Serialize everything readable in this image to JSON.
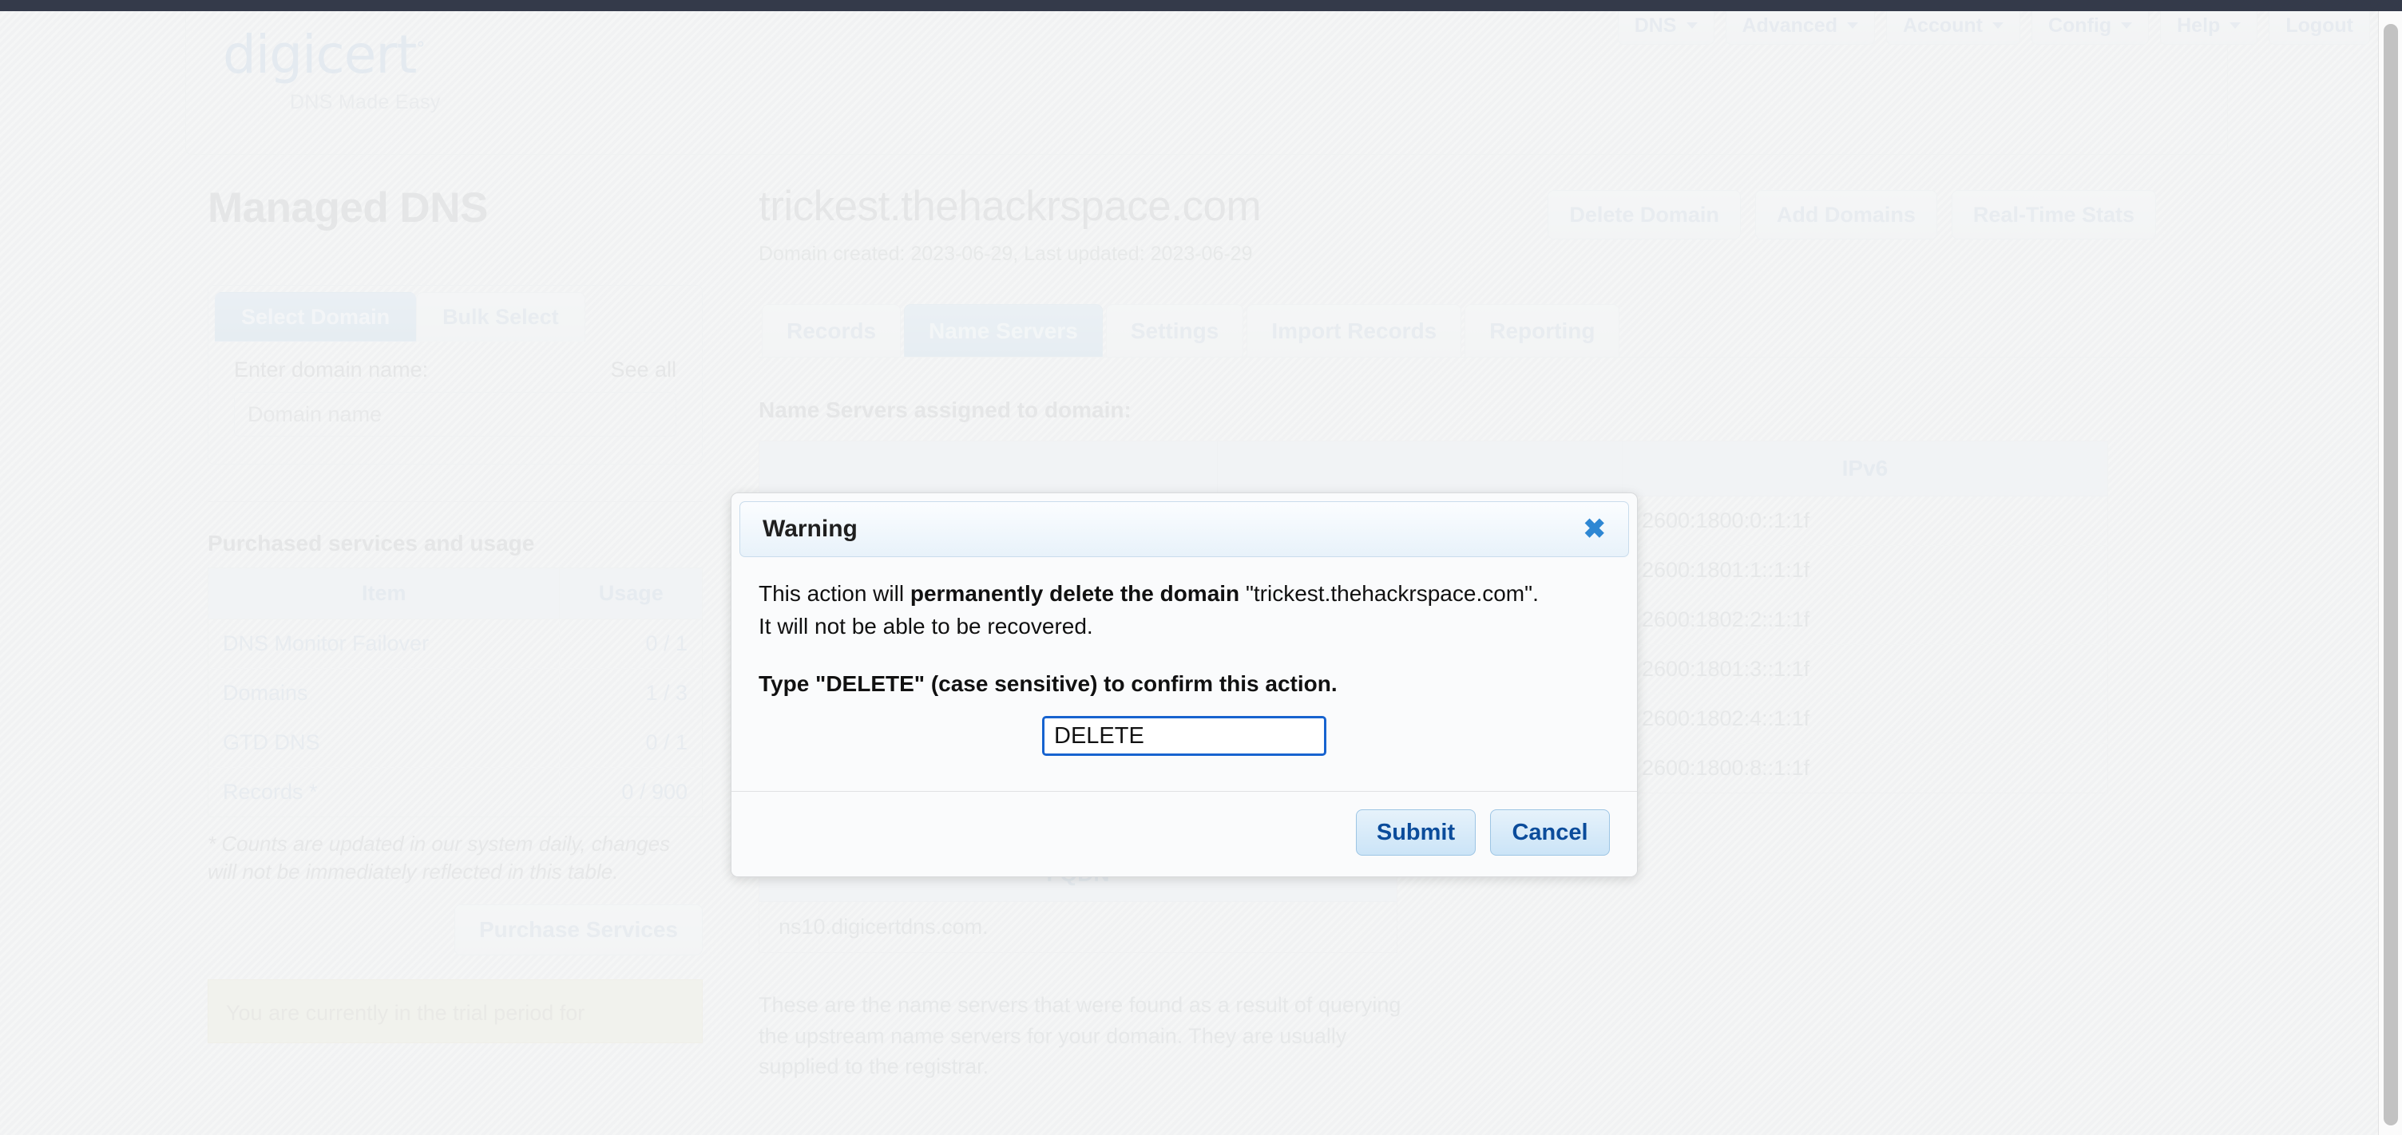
{
  "topnav": {
    "items": [
      {
        "label": "DNS",
        "has_caret": true
      },
      {
        "label": "Advanced",
        "has_caret": true
      },
      {
        "label": "Account",
        "has_caret": true
      },
      {
        "label": "Config",
        "has_caret": true
      },
      {
        "label": "Help",
        "has_caret": true
      },
      {
        "label": "Logout",
        "has_caret": false
      }
    ]
  },
  "brand": {
    "name": "digicert",
    "registered": "°",
    "tagline": "DNS Made Easy"
  },
  "sidebar": {
    "title": "Managed DNS",
    "tabs": [
      {
        "label": "Select Domain",
        "active": true
      },
      {
        "label": "Bulk Select",
        "active": false
      }
    ],
    "domain_label": "Enter domain name:",
    "see_all": "See all",
    "domain_placeholder": "Domain name",
    "domain_value": "",
    "services_title": "Purchased services and usage",
    "services_headers": [
      "Item",
      "Usage"
    ],
    "services_rows": [
      {
        "item": "DNS Monitor Failover",
        "usage": "0 / 1"
      },
      {
        "item": "Domains",
        "usage": "1 / 3"
      },
      {
        "item": "GTD DNS",
        "usage": "0 / 1"
      },
      {
        "item": "Records *",
        "usage": "0 / 900"
      }
    ],
    "services_note": "* Counts are updated in our system daily, changes will not be immediately reflected in this table.",
    "purchase_label": "Purchase Services",
    "trial_banner": "You are currently in the trial period for"
  },
  "main": {
    "domain_title": "trickest.thehackrspace.com",
    "domain_meta": "Domain created: 2023-06-29, Last updated: 2023-06-29",
    "actions": [
      {
        "label": "Delete Domain"
      },
      {
        "label": "Add Domains"
      },
      {
        "label": "Real-Time Stats"
      }
    ],
    "tabs": [
      {
        "label": "Records",
        "active": false
      },
      {
        "label": "Name Servers",
        "active": true
      },
      {
        "label": "Settings",
        "active": false
      },
      {
        "label": "Import Records",
        "active": false
      },
      {
        "label": "Reporting",
        "active": false
      }
    ],
    "ns_heading": "Name Servers assigned to domain:",
    "ns_headers": [
      "",
      "",
      "IPv6"
    ],
    "ns_rows": [
      {
        "col1": "",
        "col2": "",
        "ipv6": "2600:1800:0::1:1f"
      },
      {
        "col1": "",
        "col2": "",
        "ipv6": "2600:1801:1::1:1f"
      },
      {
        "col1": "",
        "col2": "",
        "ipv6": "2600:1802:2::1:1f"
      },
      {
        "col1": "",
        "col2": "",
        "ipv6": "2600:1801:3::1:1f"
      },
      {
        "col1": "",
        "col2": "",
        "ipv6": "2600:1802:4::1:1f"
      },
      {
        "col1": "",
        "col2": "",
        "ipv6": "2600:1800:8::1:1f"
      }
    ],
    "fqdn_header": "FQDN",
    "fqdn_rows": [
      "ns10.digicertdns.com."
    ],
    "ns_footnote": "These are the name servers that were found as a result of querying the upstream name servers for your domain. They are usually supplied to the registrar."
  },
  "modal": {
    "title": "Warning",
    "close_icon": "✖",
    "line1_a": "This action will ",
    "line1_b": "permanently delete the domain",
    "line1_c": " \"trickest.thehackrspace.com\".",
    "line2": "It will not be able to be recovered.",
    "confirm_prompt": "Type \"DELETE\" (case sensitive) to confirm this action.",
    "input_value": "DELETE",
    "input_placeholder": "",
    "submit_label": "Submit",
    "cancel_label": "Cancel"
  },
  "colors": {
    "chrome_bar": "#343a4a",
    "accent_blue": "#2e87d3",
    "button_text": "#0b4c9b",
    "input_focus": "#1763cf",
    "trial_bg": "#e9e7d4"
  }
}
